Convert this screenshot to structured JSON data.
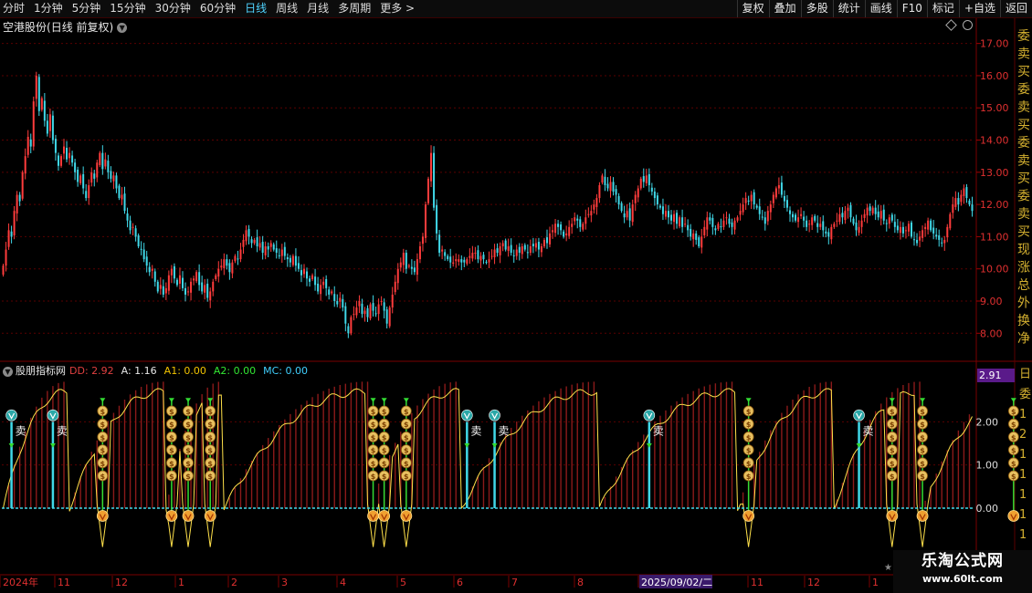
{
  "toolbar": {
    "periods": [
      "分时",
      "1分钟",
      "5分钟",
      "15分钟",
      "30分钟",
      "60分钟",
      "日线",
      "周线",
      "月线",
      "多周期",
      "更多 >"
    ],
    "active_period": "日线",
    "tools": [
      "复权",
      "叠加",
      "多股",
      "统计",
      "画线",
      "F10",
      "标记",
      "+自选",
      "返回"
    ]
  },
  "chart_title": {
    "stock_name": "空港股份",
    "mode": "(日线 前复权)"
  },
  "price_axis": {
    "ticks": [
      "17.00",
      "16.00",
      "15.00",
      "14.00",
      "13.00",
      "12.00",
      "11.00",
      "10.00",
      "9.00",
      "8.00"
    ],
    "values": [
      17,
      16,
      15,
      14,
      13,
      12,
      11,
      10,
      9,
      8
    ],
    "range": [
      7.3,
      17.5
    ]
  },
  "indicator": {
    "name": "股朋指标网",
    "dd": "DD: 2.92",
    "a": "A: 1.16",
    "a1": "A1: 0.00",
    "a2": "A2: 0.00",
    "mc": "MC: 0.00",
    "current_value": "2.91",
    "axis_ticks": [
      "2.00",
      "1.00",
      "0.00"
    ],
    "axis_values": [
      2,
      1,
      0
    ],
    "range": [
      -1.5,
      3.0
    ],
    "sell_label": "卖",
    "money_symbol": "$"
  },
  "date_axis": {
    "labels": [
      "2024年",
      "11",
      "12",
      "1",
      "2",
      "3",
      "4",
      "5",
      "6",
      "7",
      "8",
      "2025/09/02/二",
      "11",
      "12",
      "1"
    ],
    "highlight": "2025/09/02/二"
  },
  "right_panel_chars": [
    "委",
    "卖",
    "买",
    "委",
    "卖",
    "买",
    "委",
    "卖",
    "买",
    "委",
    "卖",
    "买",
    "现",
    "涨",
    "总",
    "外",
    "换",
    "净"
  ],
  "right_panel_chars_lower": [
    "日",
    "委",
    "1",
    "2",
    "1",
    "1",
    "1",
    "1",
    "1"
  ],
  "watermark": {
    "title": "乐淘公式网",
    "url": "www.60lt.com"
  },
  "colors": {
    "up": "#ff3c3c",
    "down": "#40d8e8",
    "accent": "#4fd3ff",
    "grid": "#5a0000",
    "bar_fill": "#8b1a1a",
    "signal_line": "#ffe14a",
    "buy_arrow": "#33dd33"
  },
  "chart_data": {
    "type": "candlestick",
    "sell_signal_indices": [
      3,
      18,
      168,
      178,
      234,
      310,
      392
    ],
    "buy_signal_indices": [
      36,
      61,
      67,
      75,
      134,
      138,
      146,
      270,
      322,
      333,
      366
    ],
    "zero_touch_indices": [
      36,
      61,
      67,
      75,
      134,
      138,
      146,
      270,
      322,
      333,
      366
    ],
    "period_ends": [
      23,
      58,
      79,
      132,
      165,
      215,
      265,
      300,
      332,
      370,
      395
    ],
    "closes": [
      10.1,
      10.6,
      11.2,
      11.0,
      11.8,
      12.3,
      12.1,
      13.0,
      13.5,
      14.1,
      13.8,
      15.2,
      16.0,
      14.9,
      15.3,
      14.6,
      14.2,
      14.8,
      14.0,
      13.6,
      13.2,
      13.5,
      13.8,
      13.4,
      13.6,
      13.3,
      13.0,
      12.7,
      12.9,
      12.5,
      12.2,
      12.6,
      13.0,
      12.8,
      13.3,
      13.6,
      13.1,
      13.4,
      13.0,
      12.8,
      12.9,
      12.5,
      12.2,
      12.3,
      11.8,
      11.5,
      11.2,
      11.3,
      11.0,
      10.7,
      10.6,
      10.3,
      10.1,
      9.9,
      10.0,
      9.6,
      9.3,
      9.5,
      9.2,
      9.4,
      9.8,
      10.0,
      9.7,
      9.5,
      9.8,
      9.4,
      9.2,
      9.3,
      9.6,
      9.7,
      9.9,
      9.5,
      9.3,
      9.5,
      9.1,
      9.3,
      9.6,
      9.8,
      10.0,
      10.1,
      10.3,
      10.1,
      9.9,
      10.2,
      10.4,
      10.3,
      10.6,
      10.9,
      11.2,
      11.0,
      10.8,
      10.9,
      10.7,
      10.8,
      10.5,
      10.7,
      10.6,
      10.8,
      10.6,
      10.5,
      10.4,
      10.6,
      10.4,
      10.3,
      10.2,
      10.4,
      10.1,
      10.0,
      9.8,
      10.0,
      9.7,
      9.6,
      9.8,
      9.5,
      9.3,
      9.5,
      9.6,
      9.4,
      9.2,
      9.3,
      9.0,
      8.9,
      9.1,
      8.8,
      8.3,
      8.0,
      8.5,
      8.6,
      8.8,
      9.0,
      8.6,
      8.7,
      8.5,
      8.9,
      8.7,
      8.6,
      8.9,
      9.0,
      8.7,
      8.3,
      8.8,
      9.2,
      9.6,
      10.0,
      10.2,
      10.5,
      10.0,
      10.1,
      10.0,
      9.9,
      10.3,
      10.7,
      11.0,
      12.0,
      12.8,
      13.6,
      11.9,
      11.1,
      10.5,
      10.6,
      10.4,
      10.3,
      10.2,
      10.2,
      10.3,
      10.3,
      10.2,
      10.2,
      10.3,
      10.4,
      10.5,
      10.5,
      10.3,
      10.4,
      10.3,
      10.2,
      10.3,
      10.4,
      10.6,
      10.5,
      10.7,
      10.8,
      10.6,
      10.7,
      10.5,
      10.4,
      10.6,
      10.5,
      10.7,
      10.6,
      10.5,
      10.7,
      10.7,
      10.8,
      10.6,
      10.7,
      10.9,
      10.8,
      11.1,
      11.2,
      11.4,
      11.3,
      11.2,
      11.0,
      11.1,
      11.3,
      11.4,
      11.6,
      11.5,
      11.3,
      11.4,
      11.6,
      11.7,
      11.8,
      12.0,
      12.2,
      12.6,
      12.9,
      12.6,
      12.5,
      12.7,
      12.4,
      12.3,
      12.0,
      11.8,
      11.6,
      11.8,
      11.5,
      12.0,
      12.3,
      12.5,
      12.8,
      12.7,
      12.9,
      12.6,
      12.4,
      12.2,
      12.0,
      11.9,
      11.7,
      11.8,
      11.6,
      11.5,
      11.7,
      11.4,
      11.6,
      11.3,
      11.4,
      11.2,
      11.0,
      11.1,
      10.9,
      10.7,
      11.0,
      11.3,
      11.6,
      11.5,
      11.3,
      11.2,
      11.4,
      11.3,
      11.5,
      11.6,
      11.4,
      11.3,
      11.5,
      11.6,
      11.8,
      12.0,
      12.2,
      12.1,
      12.3,
      12.0,
      11.9,
      11.7,
      11.6,
      11.4,
      11.8,
      12.0,
      12.3,
      12.5,
      12.6,
      12.3,
      12.1,
      11.9,
      11.7,
      11.6,
      11.5,
      11.6,
      11.7,
      11.5,
      11.3,
      11.4,
      11.6,
      11.5,
      11.3,
      11.4,
      11.2,
      11.1,
      11.0,
      11.3,
      11.4,
      11.5,
      11.7,
      11.6,
      11.8,
      11.9,
      11.6,
      11.4,
      11.2,
      11.3,
      11.5,
      11.7,
      11.9,
      11.8,
      11.9,
      11.7,
      11.6,
      11.8,
      11.5,
      11.4,
      11.6,
      11.5,
      11.3,
      11.2,
      11.3,
      11.1,
      11.2,
      11.4,
      11.0,
      10.9,
      10.8,
      11.0,
      11.2,
      11.3,
      11.5,
      11.2,
      11.1,
      11.0,
      10.9,
      10.8,
      10.9,
      11.3,
      11.7,
      12.0,
      12.2,
      12.0,
      12.3,
      12.5,
      12.2,
      12.0,
      11.8
    ]
  }
}
